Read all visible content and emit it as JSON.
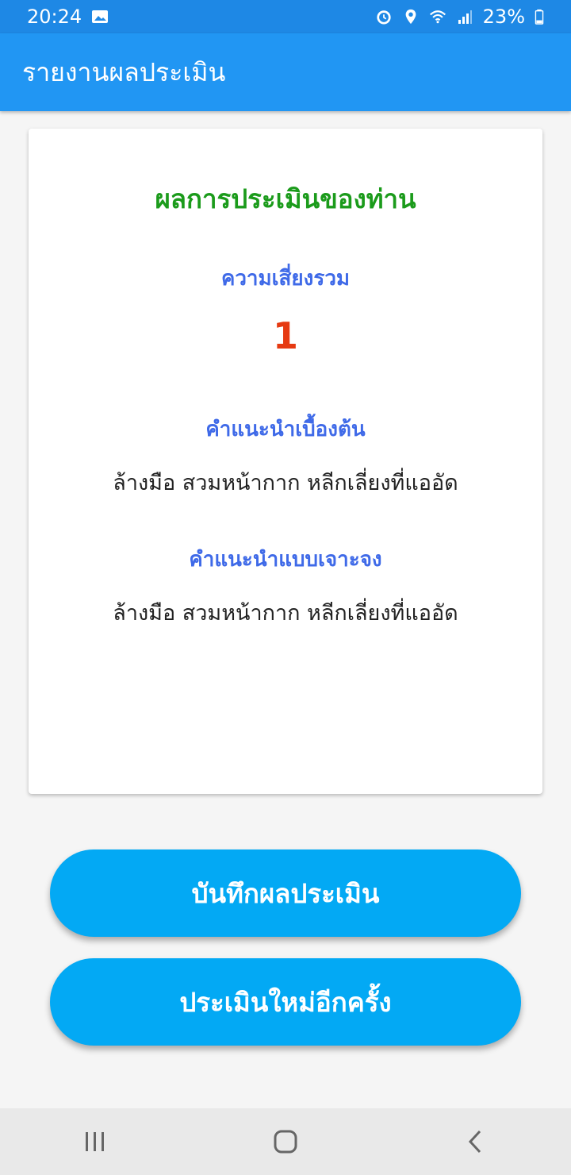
{
  "status_bar": {
    "time": "20:24",
    "battery": "23%",
    "icons": [
      "image-icon",
      "alarm-icon",
      "location-icon",
      "wifi-icon",
      "signal-icon",
      "battery-icon"
    ]
  },
  "app_bar": {
    "title": "รายงานผลประเมิน"
  },
  "card": {
    "heading": "ผลการประเมินของท่าน",
    "risk_label": "ความเสี่ยงรวม",
    "risk_value": "1",
    "basic_label": "คำแนะนำเบื้องต้น",
    "basic_text": "ล้างมือ สวมหน้ากาก หลีกเลี่ยงที่แออัด",
    "specific_label": "คำแนะนำแบบเจาะจง",
    "specific_text": "ล้างมือ สวมหน้ากาก หลีกเลี่ยงที่แออัด"
  },
  "buttons": {
    "save": "บันทึกผลประเมิน",
    "again": "ประเมินใหม่อีกครั้ง"
  },
  "nav": {
    "icons": [
      "recent-apps-icon",
      "home-icon",
      "back-icon"
    ]
  },
  "colors": {
    "status_bar": "#1e88e5",
    "app_bar": "#2196f3",
    "heading_green": "#1b9b1b",
    "label_blue": "#3f6ae8",
    "risk_red": "#e63a12",
    "button": "#03a9f4"
  }
}
